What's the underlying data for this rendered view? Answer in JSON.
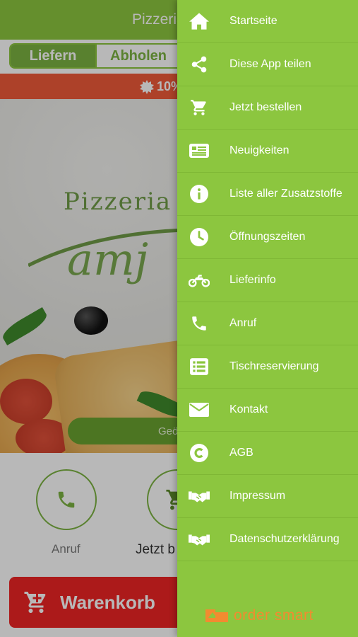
{
  "header": {
    "title": "Pizzeria"
  },
  "order_mode": {
    "deliver_label": "Liefern",
    "pickup_label": "Abholen",
    "selected": "Liefern"
  },
  "promo": {
    "text": "10%"
  },
  "geo_button": {
    "label": "Geö"
  },
  "actions": {
    "call_label": "Anruf",
    "order_label": "Jetzt b"
  },
  "cart": {
    "label": "Warenkorb"
  },
  "menu": {
    "items": [
      {
        "label": "Startseite",
        "icon": "home-icon"
      },
      {
        "label": "Diese App teilen",
        "icon": "share-icon"
      },
      {
        "label": "Jetzt bestellen",
        "icon": "cart-icon"
      },
      {
        "label": "Neuigkeiten",
        "icon": "news-icon"
      },
      {
        "label": "Liste aller Zusatzstoffe",
        "icon": "info-icon"
      },
      {
        "label": "Öffnungszeiten",
        "icon": "clock-icon"
      },
      {
        "label": "Lieferinfo",
        "icon": "motorcycle-icon"
      },
      {
        "label": "Anruf",
        "icon": "phone-icon"
      },
      {
        "label": "Tischreservierung",
        "icon": "list-icon"
      },
      {
        "label": "Kontakt",
        "icon": "mail-icon"
      },
      {
        "label": "AGB",
        "icon": "copyright-icon"
      },
      {
        "label": "Impressum",
        "icon": "handshake-icon"
      },
      {
        "label": "Datenschutzerklärung",
        "icon": "handshake-icon"
      }
    ]
  },
  "brand": {
    "name": "order smart",
    "logo": "order-smart-logo"
  },
  "colors": {
    "primary_green": "#8cc63f",
    "dark_green": "#7cb342",
    "promo_red": "#f05a3a",
    "cart_red": "#ef2424",
    "brand_orange": "#f28b30"
  }
}
